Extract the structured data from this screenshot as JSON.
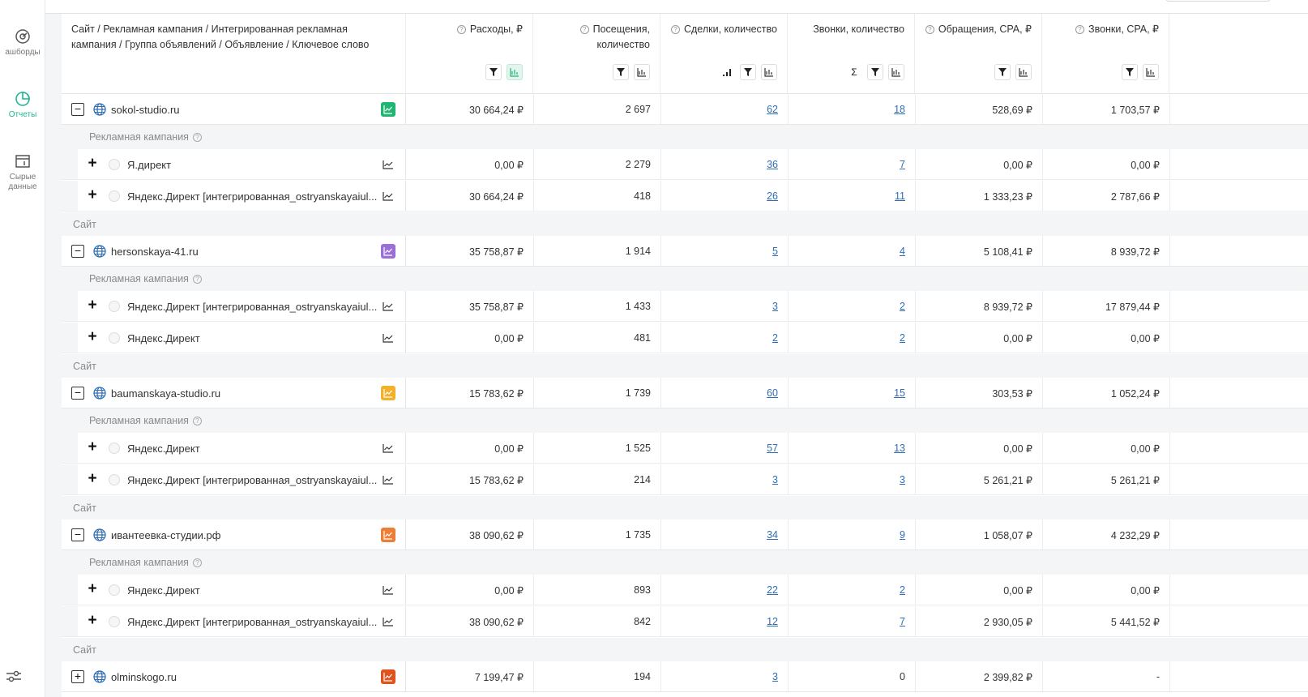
{
  "sidebar": {
    "items": [
      {
        "label": "ашборды",
        "icon": "dashboard-icon"
      },
      {
        "label": "Отчеты",
        "icon": "reports-icon",
        "active": true
      },
      {
        "label": "Сырые\nданные",
        "icon": "raw-data-icon"
      }
    ],
    "settings_icon": "settings-sliders-icon"
  },
  "header": {
    "first": "Сайт / Рекламная кампания / Интегрированная рекламная кампания / Группа объявлений / Объявление / Ключевое слово",
    "columns": [
      {
        "title": "Расходы, ₽",
        "help": true
      },
      {
        "title": "Посещения, количество",
        "help": true
      },
      {
        "title": "Сделки, количество",
        "help": true
      },
      {
        "title": "Звонки, количество",
        "help": false
      },
      {
        "title": "Обращения, CPA, ₽",
        "help": true
      },
      {
        "title": "Звонки, CPA, ₽",
        "help": true
      }
    ]
  },
  "labels": {
    "campaign_group": "Рекламная кампания",
    "site_group": "Сайт"
  },
  "sites": [
    {
      "name": "sokol-studio.ru",
      "chart_color": "#21b573",
      "toggle": "−",
      "values": [
        "30 664,24 ₽",
        "2 697",
        "62",
        "18",
        "528,69 ₽",
        "1 703,57 ₽"
      ],
      "campaigns": [
        {
          "name": "Я.директ",
          "values": [
            "0,00 ₽",
            "2 279",
            "36",
            "7",
            "0,00 ₽",
            "0,00 ₽"
          ]
        },
        {
          "name": "Яндекс.Директ [интегрированная_ostryanskayaiul...",
          "values": [
            "30 664,24 ₽",
            "418",
            "26",
            "11",
            "1 333,23 ₽",
            "2 787,66 ₽"
          ]
        }
      ]
    },
    {
      "name": "hersonskaya-41.ru",
      "chart_color": "#9b6fd6",
      "toggle": "−",
      "values": [
        "35 758,87 ₽",
        "1 914",
        "5",
        "4",
        "5 108,41 ₽",
        "8 939,72 ₽"
      ],
      "campaigns": [
        {
          "name": "Яндекс.Директ [интегрированная_ostryanskayaiul...",
          "values": [
            "35 758,87 ₽",
            "1 433",
            "3",
            "2",
            "8 939,72 ₽",
            "17 879,44 ₽"
          ]
        },
        {
          "name": "Яндекс.Директ",
          "values": [
            "0,00 ₽",
            "481",
            "2",
            "2",
            "0,00 ₽",
            "0,00 ₽"
          ]
        }
      ]
    },
    {
      "name": "baumanskaya-studio.ru",
      "chart_color": "#f2b12b",
      "toggle": "−",
      "values": [
        "15 783,62 ₽",
        "1 739",
        "60",
        "15",
        "303,53 ₽",
        "1 052,24 ₽"
      ],
      "campaigns": [
        {
          "name": "Яндекс.Директ",
          "values": [
            "0,00 ₽",
            "1 525",
            "57",
            "13",
            "0,00 ₽",
            "0,00 ₽"
          ]
        },
        {
          "name": "Яндекс.Директ [интегрированная_ostryanskayaiul...",
          "values": [
            "15 783,62 ₽",
            "214",
            "3",
            "3",
            "5 261,21 ₽",
            "5 261,21 ₽"
          ]
        }
      ]
    },
    {
      "name": "ивантеевка-студии.рф",
      "chart_color": "#ee7d36",
      "toggle": "−",
      "values": [
        "38 090,62 ₽",
        "1 735",
        "34",
        "9",
        "1 058,07 ₽",
        "4 232,29 ₽"
      ],
      "campaigns": [
        {
          "name": "Яндекс.Директ",
          "values": [
            "0,00 ₽",
            "893",
            "22",
            "2",
            "0,00 ₽",
            "0,00 ₽"
          ]
        },
        {
          "name": "Яндекс.Директ [интегрированная_ostryanskayaiul...",
          "values": [
            "38 090,62 ₽",
            "842",
            "12",
            "7",
            "2 930,05 ₽",
            "5 441,52 ₽"
          ]
        }
      ]
    },
    {
      "name": "olminskogo.ru",
      "chart_color": "#e0531f",
      "toggle": "+",
      "values": [
        "7 199,47 ₽",
        "194",
        "3",
        "0",
        "2 399,82 ₽",
        "-"
      ],
      "campaigns": []
    }
  ]
}
